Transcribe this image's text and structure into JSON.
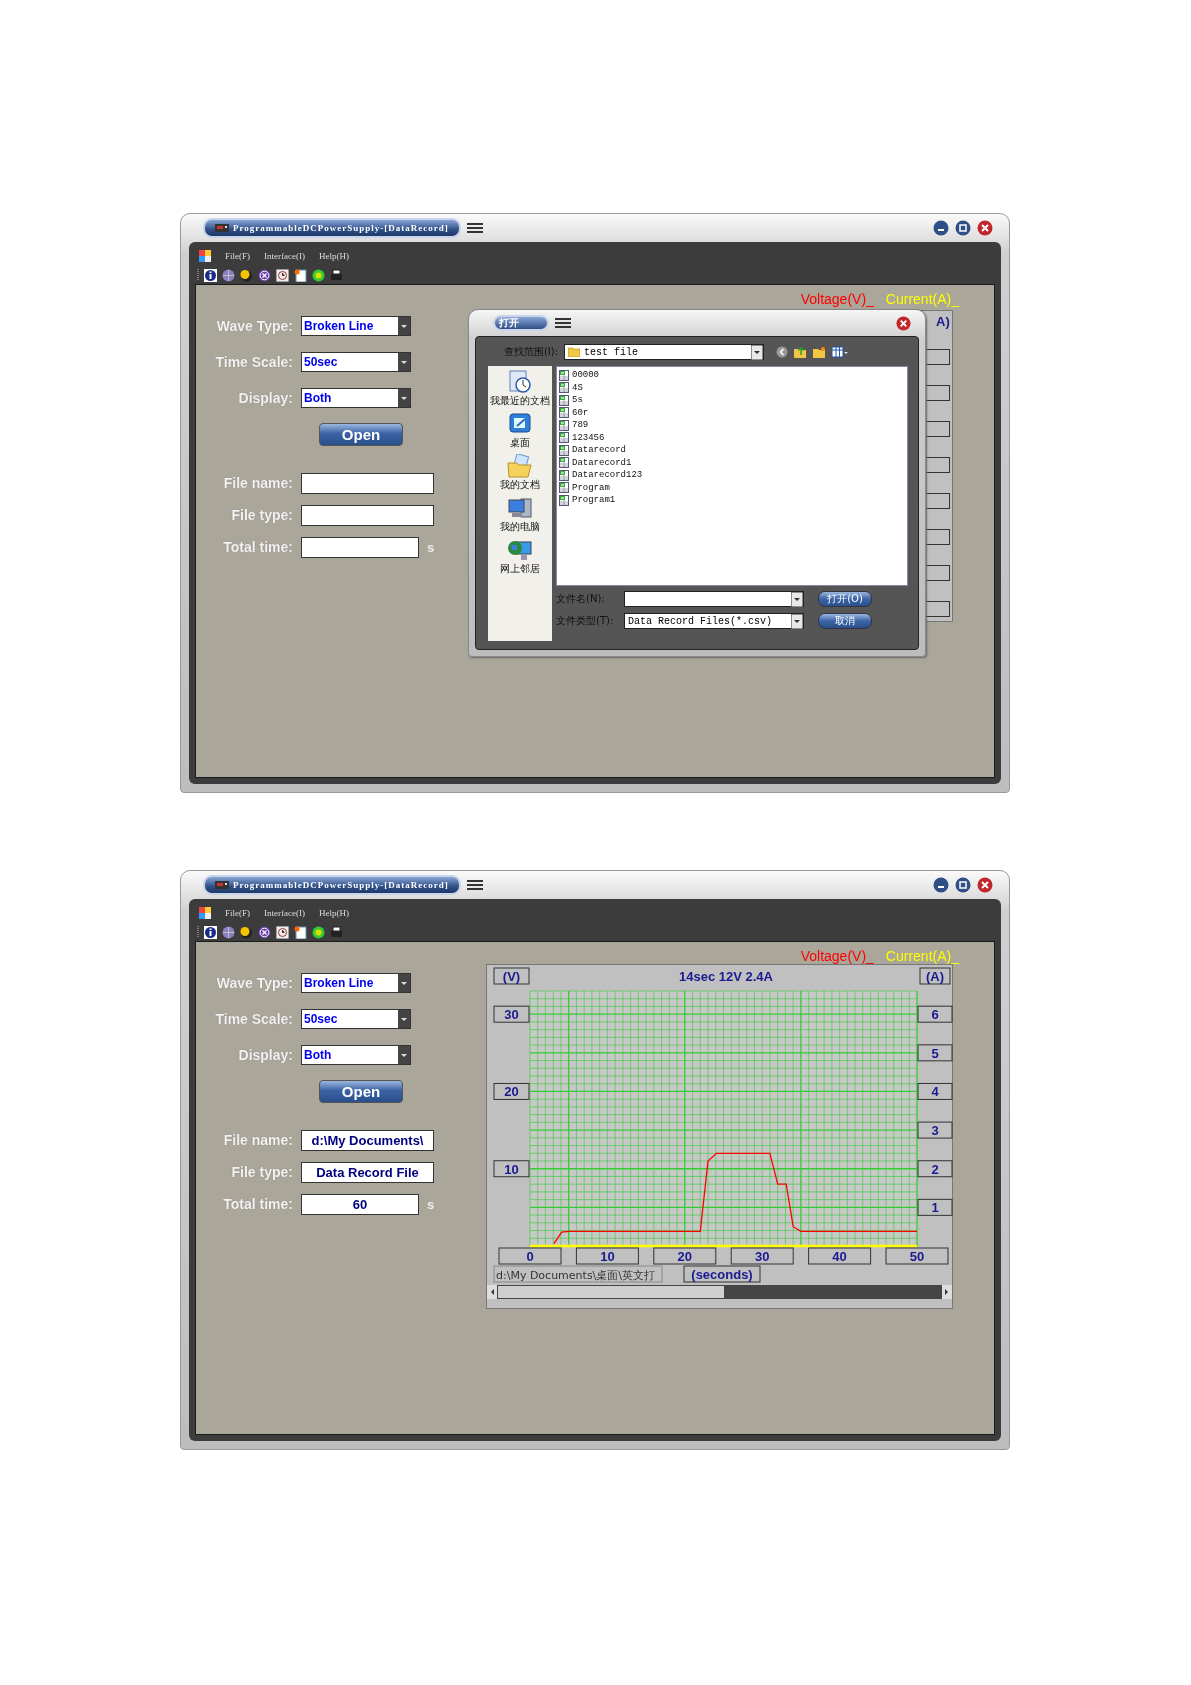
{
  "windows": [
    {
      "title": "ProgrammableDCPowerSupply-[DataRecord]",
      "menu": [
        "File(F)",
        "Interface(I)",
        "Help(H)"
      ],
      "legend": [
        {
          "label": "Voltage(V)_",
          "color": "#ff0000"
        },
        {
          "label": "Current(A)_",
          "color": "#ffff00"
        }
      ],
      "form": {
        "selects": [
          {
            "label": "Wave Type:",
            "value": "Broken Line"
          },
          {
            "label": "Time Scale:",
            "value": "50sec"
          },
          {
            "label": "Display:",
            "value": "Both"
          }
        ],
        "open_button": "Open",
        "fields": [
          {
            "label": "File name:"
          },
          {
            "label": "File type:"
          },
          {
            "label": "Total time:",
            "unit": "s"
          }
        ]
      },
      "chart_partial": {
        "unit_label": "A)"
      },
      "dialog": {
        "title": "打开",
        "look_in_label": "查找范围(I):",
        "look_in": "test file",
        "places": [
          {
            "label": "我最近的文档",
            "kind": "recent"
          },
          {
            "label": "桌面",
            "kind": "desktop"
          },
          {
            "label": "我的文档",
            "kind": "documents"
          },
          {
            "label": "我的电脑",
            "kind": "computer"
          },
          {
            "label": "网上邻居",
            "kind": "network"
          }
        ],
        "files": [
          "00000",
          "4S",
          "5s",
          "60r",
          "789",
          "123456",
          "Datarecord",
          "Datarecord1",
          "Datarecord123",
          "Program",
          "Program1"
        ],
        "file_name_label": "文件名(N):",
        "file_type_label": "文件类型(T):",
        "file_type": "Data Record Files(*.csv)",
        "buttons": [
          "打开(O)",
          "取消"
        ]
      }
    },
    {
      "title": "ProgrammableDCPowerSupply-[DataRecord]",
      "menu": [
        "File(F)",
        "Interface(I)",
        "Help(H)"
      ],
      "form": {
        "selects": [
          {
            "label": "Wave Type:",
            "value": "Broken Line"
          },
          {
            "label": "Time Scale:",
            "value": "50sec"
          },
          {
            "label": "Display:",
            "value": "Both"
          }
        ],
        "open_button": "Open",
        "fields": [
          {
            "label": "File name:",
            "value": "d:\\My Documents\\"
          },
          {
            "label": "File type:",
            "value": "Data Record File"
          },
          {
            "label": "Total time:",
            "value": "60",
            "unit": "s"
          }
        ]
      },
      "chart": {
        "top_label": "14sec 12V 2.4A",
        "left_unit": "(V)",
        "right_unit": "(A)",
        "right_ticks": [
          "6",
          "5",
          "4",
          "3",
          "2",
          "1"
        ],
        "path": "d:\\My Documents\\桌面\\英文打",
        "chart_data": {
          "type": "line",
          "xlabel": "(seconds)",
          "x": [
            0,
            3.1,
            4.1,
            5,
            22,
            23,
            24.1,
            31,
            32,
            33.1,
            34,
            35,
            50
          ],
          "series": [
            {
              "name": "Voltage(V)_",
              "color": "#ff0000",
              "values": [
                null,
                0.3,
                1.8,
                1.9,
                1.9,
                11,
                12,
                12,
                8,
                8,
                2.5,
                1.9,
                1.9
              ]
            },
            {
              "name": "Current(A)_",
              "color": "#ffff00",
              "values": [
                0,
                0,
                0,
                0,
                0,
                0,
                0,
                0,
                0,
                0,
                0,
                0,
                0
              ]
            }
          ],
          "grid": true,
          "xlim": [
            0,
            50
          ],
          "ylim": [
            0,
            33
          ],
          "xticks": [
            0,
            10,
            20,
            30,
            40,
            50
          ],
          "yticks": [
            10,
            20,
            30
          ]
        }
      }
    }
  ]
}
